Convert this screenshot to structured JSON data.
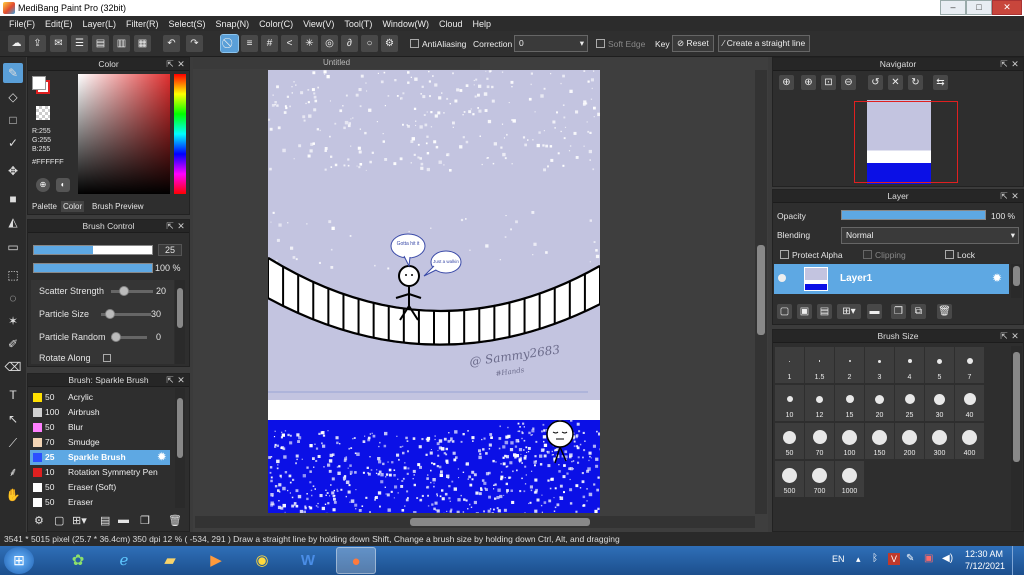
{
  "window": {
    "title": "MediBang Paint Pro (32bit)",
    "min_label": "–",
    "max_label": "□",
    "close_label": "✕"
  },
  "menu": [
    "File(F)",
    "Edit(E)",
    "Layer(L)",
    "Filter(R)",
    "Select(S)",
    "Snap(N)",
    "Color(C)",
    "View(V)",
    "Tool(T)",
    "Window(W)",
    "Cloud",
    "Help"
  ],
  "toolbar": {
    "antialiasing_label": "AntiAliasing",
    "correction_label": "Correction",
    "correction_value": "0",
    "soft_edge_label": "Soft Edge",
    "key_label": "Key",
    "reset_label": "Reset",
    "straight_line_label": "Create a straight line"
  },
  "color_panel": {
    "title": "Color",
    "r": "R:255",
    "g": "G:255",
    "b": "B:255",
    "hex": "#FFFFFF",
    "tabs": [
      "Palette",
      "Color",
      "Brush Preview"
    ],
    "primary_color": "#ffffff",
    "secondary_color": "#e02020"
  },
  "brush_control": {
    "title": "Brush Control",
    "size_value": "25",
    "size_fraction": 0.5,
    "opacity_value": "100 %",
    "opacity_fraction": 1.0,
    "scatter_label": "Scatter Strength",
    "scatter_value": "20",
    "particle_size_label": "Particle Size",
    "particle_size_value": "30",
    "particle_random_label": "Particle Random",
    "particle_random_value": "0",
    "rotate_label": "Rotate Along"
  },
  "brush_list": {
    "title": "Brush: Sparkle Brush",
    "items": [
      {
        "size": "50",
        "name": "Acrylic",
        "color": "#ffe000"
      },
      {
        "size": "100",
        "name": "Airbrush",
        "color": "#d0d0d0"
      },
      {
        "size": "50",
        "name": "Blur",
        "color": "#ff80ff"
      },
      {
        "size": "70",
        "name": "Smudge",
        "color": "#f3d5b5"
      },
      {
        "size": "25",
        "name": "Sparkle Brush",
        "color": "#2b50ff"
      },
      {
        "size": "10",
        "name": "Rotation Symmetry Pen",
        "color": "#e02020"
      },
      {
        "size": "50",
        "name": "Eraser (Soft)",
        "color": "#ffffff"
      },
      {
        "size": "50",
        "name": "Eraser",
        "color": "#ffffff"
      }
    ]
  },
  "canvas": {
    "tab_title": "Untitled",
    "signature": "@ Sammy2683",
    "signature_sub": "#Hands",
    "bubble1": "Gotta hit it",
    "bubble2": "Just a walkin"
  },
  "navigator": {
    "title": "Navigator"
  },
  "layer_panel": {
    "title": "Layer",
    "opacity_label": "Opacity",
    "opacity_value": "100 %",
    "opacity_fraction": 1.0,
    "blending_label": "Blending",
    "blending_value": "Normal",
    "protect_alpha_label": "Protect Alpha",
    "clipping_label": "Clipping",
    "lock_label": "Lock",
    "layer_name": "Layer1"
  },
  "brush_size_panel": {
    "title": "Brush Size",
    "sizes": [
      "1",
      "1.5",
      "2",
      "3",
      "4",
      "5",
      "7",
      "10",
      "12",
      "15",
      "20",
      "25",
      "30",
      "40",
      "50",
      "70",
      "100",
      "150",
      "200",
      "300",
      "400",
      "500",
      "700",
      "1000"
    ]
  },
  "status": {
    "text": "3541 * 5015 pixel   (25.7 * 36.4cm)   350 dpi   12 %   ( -534, 291 )   Draw a straight line by holding down Shift, Change a brush size by holding down Ctrl, Alt, and dragging"
  },
  "taskbar": {
    "lang": "EN",
    "time": "12:30 AM",
    "date": "7/12/2021"
  }
}
